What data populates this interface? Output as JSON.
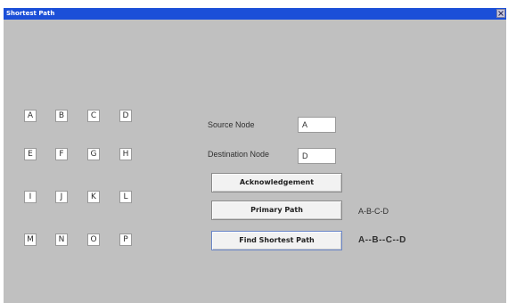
{
  "window": {
    "title": "Shortest Path",
    "close_glyph": "X"
  },
  "nodes": [
    "A",
    "B",
    "C",
    "D",
    "E",
    "F",
    "G",
    "H",
    "I",
    "J",
    "K",
    "L",
    "M",
    "N",
    "O",
    "P"
  ],
  "form": {
    "source_label": "Source Node",
    "source_value": "A",
    "destination_label": "Destination Node",
    "destination_value": "D"
  },
  "buttons": {
    "acknowledgement": "Acknowledgement",
    "primary_path": "Primary Path",
    "find_shortest_path": "Find Shortest Path"
  },
  "results": {
    "primary_path": "A-B-C-D",
    "shortest_path": "A--B--C--D"
  },
  "colors": {
    "titlebar": "#1b4fd8",
    "window_bg": "#c0c0c0"
  }
}
